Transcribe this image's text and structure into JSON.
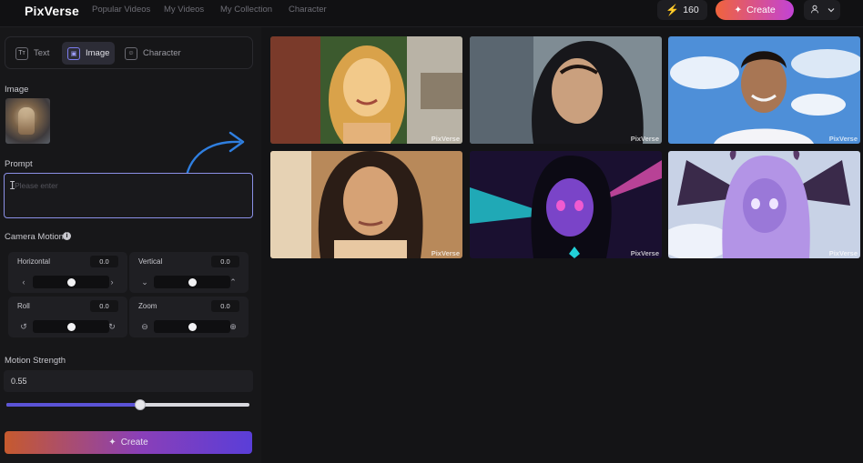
{
  "header": {
    "logo": "PixVerse",
    "nav": [
      "Popular Videos",
      "My Videos",
      "My Collection",
      "Character"
    ],
    "credits": "160",
    "create_label": "Create",
    "user_icon": "user-icon",
    "chevron_icon": "chevron-down-icon"
  },
  "sidebar": {
    "tabs": [
      {
        "label": "Text",
        "icon": "Tт",
        "active": false
      },
      {
        "label": "Image",
        "icon": "▣",
        "active": true
      },
      {
        "label": "Character",
        "icon": "☺",
        "active": false
      }
    ],
    "image_label": "Image",
    "prompt_label": "Prompt",
    "prompt_placeholder": "Please enter",
    "camera_motion_label": "Camera Motion",
    "camera": [
      {
        "name": "Horizontal",
        "value": "0.0",
        "left_icon": "‹",
        "right_icon": "›",
        "level": 0.5
      },
      {
        "name": "Vertical",
        "value": "0.0",
        "left_icon": "⌄",
        "right_icon": "⌃",
        "level": 0.5
      },
      {
        "name": "Roll",
        "value": "0.0",
        "left_icon": "↺",
        "right_icon": "↻",
        "level": 0.5
      },
      {
        "name": "Zoom",
        "value": "0.0",
        "left_icon": "⊖",
        "right_icon": "⊕",
        "level": 0.5
      }
    ],
    "motion_strength_label": "Motion Strength",
    "motion_strength_value": "0.55",
    "motion_strength_level": 0.55,
    "create_label": "Create",
    "accent": "#5b53d6"
  },
  "gallery": {
    "watermark": "PixVerse",
    "items": [
      {
        "name": "gallery-card-blonde-girl",
        "colors": [
          "#4b7a3a",
          "#d9a24a",
          "#f2c98a",
          "#7e8f5a"
        ]
      },
      {
        "name": "gallery-card-woman-hijab",
        "colors": [
          "#6f7d86",
          "#caa07e",
          "#1a1a1e",
          "#8d9aa2"
        ]
      },
      {
        "name": "gallery-card-smiling-man",
        "colors": [
          "#4e8fd8",
          "#cfe2f6",
          "#a87654",
          "#f0f0f4"
        ]
      },
      {
        "name": "gallery-card-freckled-girl",
        "colors": [
          "#a77a4a",
          "#d6a275",
          "#2b1d16",
          "#e8c8a2"
        ]
      },
      {
        "name": "gallery-card-purple-anime",
        "colors": [
          "#1a1030",
          "#7a44c8",
          "#22d0d8",
          "#e04fb0"
        ]
      },
      {
        "name": "gallery-card-lavender-anime",
        "colors": [
          "#c8d2e6",
          "#b394e6",
          "#3a2a4a",
          "#efe6ff"
        ]
      }
    ]
  }
}
